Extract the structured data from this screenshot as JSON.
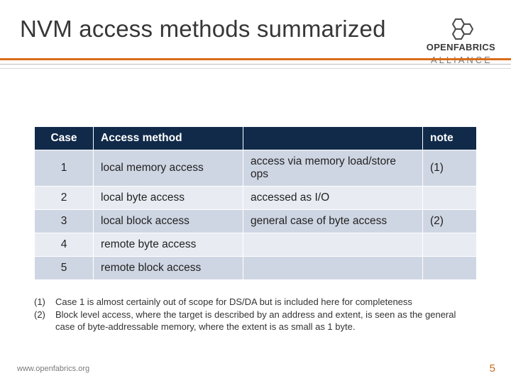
{
  "title": "NVM access methods summarized",
  "brand": {
    "line1": "OPENFABRICS",
    "line2": "ALLIANCE"
  },
  "table": {
    "headers": {
      "case": "Case",
      "method": "Access method",
      "desc": "",
      "note": "note"
    },
    "rows": [
      {
        "case": "1",
        "method": "local memory access",
        "desc": "access via memory load/store ops",
        "note": "(1)"
      },
      {
        "case": "2",
        "method": "local byte access",
        "desc": "accessed as I/O",
        "note": ""
      },
      {
        "case": "3",
        "method": "local block access",
        "desc": "general case of byte access",
        "note": "(2)"
      },
      {
        "case": "4",
        "method": "remote byte access",
        "desc": "",
        "note": ""
      },
      {
        "case": "5",
        "method": "remote block access",
        "desc": "",
        "note": ""
      }
    ]
  },
  "footnotes": [
    {
      "num": "(1)",
      "text": "Case 1 is almost certainly out of scope for DS/DA but is included here for completeness"
    },
    {
      "num": "(2)",
      "text": "Block level access, where the target is described by an address and extent, is seen as the general case of byte-addressable memory, where the extent is as small as 1 byte."
    }
  ],
  "footer_url": "www.openfabrics.org",
  "page_number": "5"
}
